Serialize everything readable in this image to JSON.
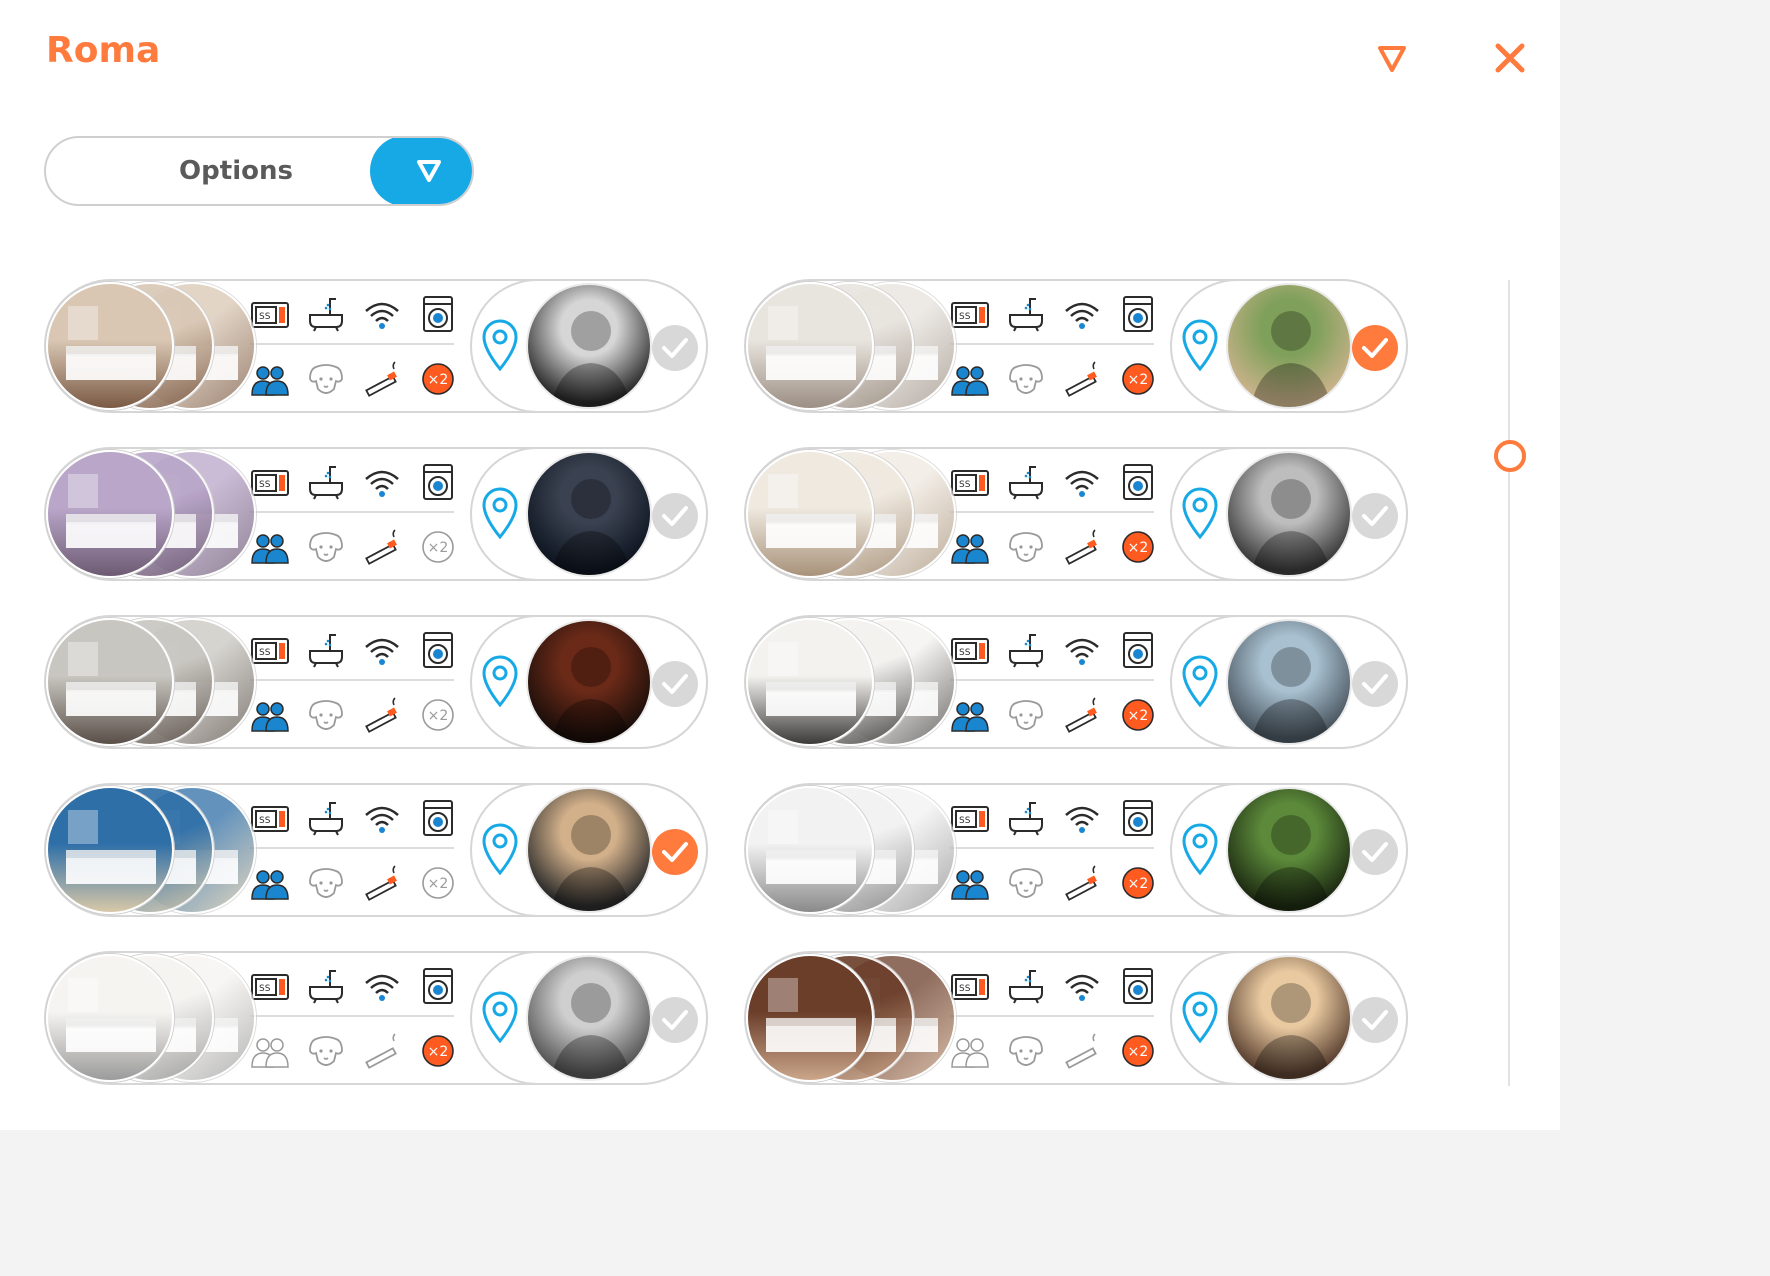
{
  "header": {
    "title": "Roma",
    "filter_icon": "triangle-filter-icon",
    "close_icon": "close-icon"
  },
  "options": {
    "label": "Options",
    "toggle_icon": "triangle-down-icon"
  },
  "colors": {
    "accent": "#ff7a3d",
    "blue": "#17a9e6",
    "border": "#d6d6d6"
  },
  "listings": [
    {
      "people": true,
      "extra": true,
      "smoking": true,
      "checked": false,
      "room": "bedroom-1",
      "host": "host-1"
    },
    {
      "people": true,
      "extra": true,
      "smoking": true,
      "checked": true,
      "room": "bedroom-2",
      "host": "host-2"
    },
    {
      "people": true,
      "extra": false,
      "smoking": true,
      "checked": false,
      "room": "bedroom-3",
      "host": "host-3"
    },
    {
      "people": true,
      "extra": true,
      "smoking": true,
      "checked": false,
      "room": "bedroom-4",
      "host": "host-4"
    },
    {
      "people": true,
      "extra": false,
      "smoking": true,
      "checked": false,
      "room": "bedroom-5",
      "host": "host-5"
    },
    {
      "people": true,
      "extra": true,
      "smoking": true,
      "checked": false,
      "room": "bedroom-6",
      "host": "host-6"
    },
    {
      "people": true,
      "extra": false,
      "smoking": true,
      "checked": true,
      "room": "bedroom-7",
      "host": "host-7"
    },
    {
      "people": true,
      "extra": true,
      "smoking": true,
      "checked": false,
      "room": "bedroom-8",
      "host": "host-8"
    },
    {
      "people": false,
      "extra": true,
      "smoking": false,
      "checked": false,
      "room": "bedroom-9",
      "host": "host-9"
    },
    {
      "people": false,
      "extra": true,
      "smoking": false,
      "checked": false,
      "room": "bedroom-10",
      "host": "host-10"
    }
  ],
  "amenity_icons": [
    "microwave-icon",
    "bathtub-icon",
    "wifi-icon",
    "washing-machine-icon",
    "people-icon",
    "pet-dog-icon",
    "smoking-icon",
    "double-occupancy-icon"
  ],
  "extra_badge": "×2"
}
